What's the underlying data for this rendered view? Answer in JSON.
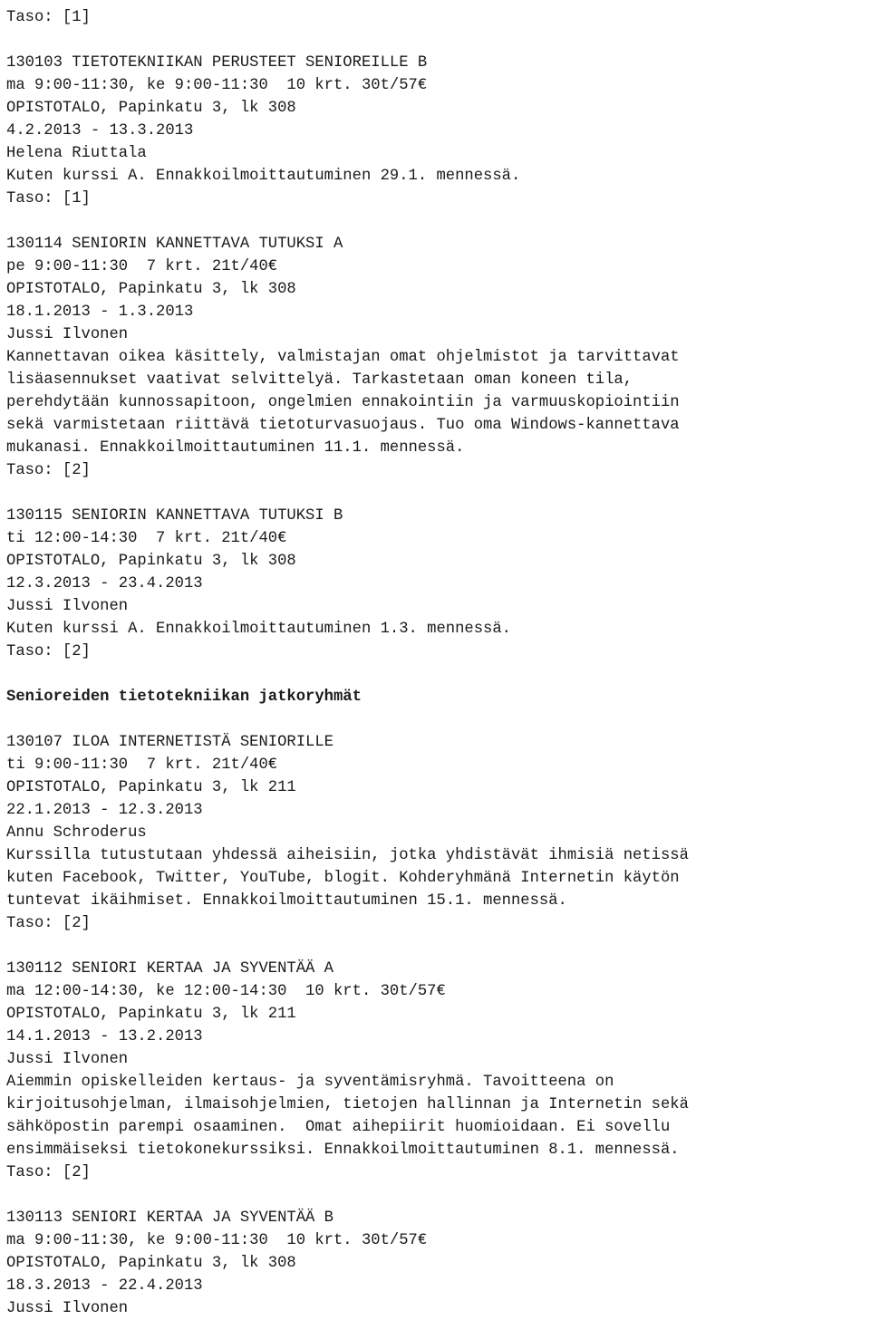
{
  "document": {
    "type": "course-catalogue-listing",
    "language": "fi",
    "text_color": "#1a1a1a",
    "background_color": "#ffffff",
    "lines": [
      "Taso: [1]",
      "",
      "130103 TIETOTEKNIIKAN PERUSTEET SENIOREILLE B",
      "ma 9:00-11:30, ke 9:00-11:30  10 krt. 30t/57€",
      "OPISTOTALO, Papinkatu 3, lk 308",
      "4.2.2013 - 13.3.2013",
      "Helena Riuttala",
      "Kuten kurssi A. Ennakkoilmoittautuminen 29.1. mennessä.",
      "Taso: [1]",
      "",
      "130114 SENIORIN KANNETTAVA TUTUKSI A",
      "pe 9:00-11:30  7 krt. 21t/40€",
      "OPISTOTALO, Papinkatu 3, lk 308",
      "18.1.2013 - 1.3.2013",
      "Jussi Ilvonen",
      "Kannettavan oikea käsittely, valmistajan omat ohjelmistot ja tarvittavat",
      "lisäasennukset vaativat selvittelyä. Tarkastetaan oman koneen tila,",
      "perehdytään kunnossapitoon, ongelmien ennakointiin ja varmuuskopiointiin",
      "sekä varmistetaan riittävä tietoturvasuojaus. Tuo oma Windows-kannettava",
      "mukanasi. Ennakkoilmoittautuminen 11.1. mennessä.",
      "Taso: [2]",
      "",
      "130115 SENIORIN KANNETTAVA TUTUKSI B",
      "ti 12:00-14:30  7 krt. 21t/40€",
      "OPISTOTALO, Papinkatu 3, lk 308",
      "12.3.2013 - 23.4.2013",
      "Jussi Ilvonen",
      "Kuten kurssi A. Ennakkoilmoittautuminen 1.3. mennessä.",
      "Taso: [2]",
      "",
      "Senioreiden tietotekniikan jatkoryhmät",
      "",
      "130107 ILOA INTERNETISTÄ SENIORILLE",
      "ti 9:00-11:30  7 krt. 21t/40€",
      "OPISTOTALO, Papinkatu 3, lk 211",
      "22.1.2013 - 12.3.2013",
      "Annu Schroderus",
      "Kurssilla tutustutaan yhdessä aiheisiin, jotka yhdistävät ihmisiä netissä",
      "kuten Facebook, Twitter, YouTube, blogit. Kohderyhmänä Internetin käytön",
      "tuntevat ikäihmiset. Ennakkoilmoittautuminen 15.1. mennessä.",
      "Taso: [2]",
      "",
      "130112 SENIORI KERTAA JA SYVENTÄÄ A",
      "ma 12:00-14:30, ke 12:00-14:30  10 krt. 30t/57€",
      "OPISTOTALO, Papinkatu 3, lk 211",
      "14.1.2013 - 13.2.2013",
      "Jussi Ilvonen",
      "Aiemmin opiskelleiden kertaus- ja syventämisryhmä. Tavoitteena on",
      "kirjoitusohjelman, ilmaisohjelmien, tietojen hallinnan ja Internetin sekä",
      "sähköpostin parempi osaaminen.  Omat aihepiirit huomioidaan. Ei sovellu",
      "ensimmäiseksi tietokonekurssiksi. Ennakkoilmoittautuminen 8.1. mennessä.",
      "Taso: [2]",
      "",
      "130113 SENIORI KERTAA JA SYVENTÄÄ B",
      "ma 9:00-11:30, ke 9:00-11:30  10 krt. 30t/57€",
      "OPISTOTALO, Papinkatu 3, lk 308",
      "18.3.2013 - 22.4.2013",
      "Jussi Ilvonen"
    ],
    "bold_line_indices": [
      30
    ],
    "section_heading": "Senioreiden tietotekniikan jatkoryhmät",
    "courses": [
      {
        "level": "Taso: [1]",
        "code": "130103",
        "title": "TIETOTEKNIIKAN PERUSTEET SENIOREILLE B",
        "schedule": "ma 9:00-11:30, ke 9:00-11:30  10 krt. 30t/57€",
        "times": "10 krt.",
        "hours_price": "30t/57€",
        "venue": "OPISTOTALO, Papinkatu 3, lk 308",
        "room": "lk 308",
        "dates": "4.2.2013 - 13.3.2013",
        "teacher": "Helena Riuttala",
        "description": "Kuten kurssi A. Ennakkoilmoittautuminen 29.1. mennessä.",
        "enrol_deadline": "29.1."
      },
      {
        "level": "Taso: [1]",
        "code": "130114",
        "title": "SENIORIN KANNETTAVA TUTUKSI A",
        "schedule": "pe 9:00-11:30  7 krt. 21t/40€",
        "times": "7 krt.",
        "hours_price": "21t/40€",
        "venue": "OPISTOTALO, Papinkatu 3, lk 308",
        "room": "lk 308",
        "dates": "18.1.2013 - 1.3.2013",
        "teacher": "Jussi Ilvonen",
        "description": "Kannettavan oikea käsittely, valmistajan omat ohjelmistot ja tarvittavat lisäasennukset vaativat selvittelyä. Tarkastetaan oman koneen tila, perehdytään kunnossapitoon, ongelmien ennakointiin ja varmuuskopiointiin sekä varmistetaan riittävä tietoturvasuojaus. Tuo oma Windows-kannettava mukanasi. Ennakkoilmoittautuminen 11.1. mennessä.",
        "enrol_deadline": "11.1."
      },
      {
        "level": "Taso: [2]",
        "code": "130115",
        "title": "SENIORIN KANNETTAVA TUTUKSI B",
        "schedule": "ti 12:00-14:30  7 krt. 21t/40€",
        "times": "7 krt.",
        "hours_price": "21t/40€",
        "venue": "OPISTOTALO, Papinkatu 3, lk 308",
        "room": "lk 308",
        "dates": "12.3.2013 - 23.4.2013",
        "teacher": "Jussi Ilvonen",
        "description": "Kuten kurssi A. Ennakkoilmoittautuminen 1.3. mennessä.",
        "enrol_deadline": "1.3."
      },
      {
        "level": "Taso: [2]",
        "code": "130107",
        "title": "ILOA INTERNETISTÄ SENIORILLE",
        "schedule": "ti 9:00-11:30  7 krt. 21t/40€",
        "times": "7 krt.",
        "hours_price": "21t/40€",
        "venue": "OPISTOTALO, Papinkatu 3, lk 211",
        "room": "lk 211",
        "dates": "22.1.2013 - 12.3.2013",
        "teacher": "Annu Schroderus",
        "description": "Kurssilla tutustutaan yhdessä aiheisiin, jotka yhdistävät ihmisiä netissä kuten Facebook, Twitter, YouTube, blogit. Kohderyhmänä Internetin käytön tuntevat ikäihmiset. Ennakkoilmoittautuminen 15.1. mennessä.",
        "enrol_deadline": "15.1."
      },
      {
        "level": "Taso: [2]",
        "code": "130112",
        "title": "SENIORI KERTAA JA SYVENTÄÄ A",
        "schedule": "ma 12:00-14:30, ke 12:00-14:30  10 krt. 30t/57€",
        "times": "10 krt.",
        "hours_price": "30t/57€",
        "venue": "OPISTOTALO, Papinkatu 3, lk 211",
        "room": "lk 211",
        "dates": "14.1.2013 - 13.2.2013",
        "teacher": "Jussi Ilvonen",
        "description": "Aiemmin opiskelleiden kertaus- ja syventämisryhmä. Tavoitteena on kirjoitusohjelman, ilmaisohjelmien, tietojen hallinnan ja Internetin sekä sähköpostin parempi osaaminen.  Omat aihepiirit huomioidaan. Ei sovellu ensimmäiseksi tietokonekurssiksi. Ennakkoilmoittautuminen 8.1. mennessä.",
        "enrol_deadline": "8.1."
      },
      {
        "level": "Taso: [2]",
        "code": "130113",
        "title": "SENIORI KERTAA JA SYVENTÄÄ B",
        "schedule": "ma 9:00-11:30, ke 9:00-11:30  10 krt. 30t/57€",
        "times": "10 krt.",
        "hours_price": "30t/57€",
        "venue": "OPISTOTALO, Papinkatu 3, lk 308",
        "room": "lk 308",
        "dates": "18.3.2013 - 22.4.2013",
        "teacher": "Jussi Ilvonen",
        "description": "",
        "enrol_deadline": ""
      }
    ]
  }
}
